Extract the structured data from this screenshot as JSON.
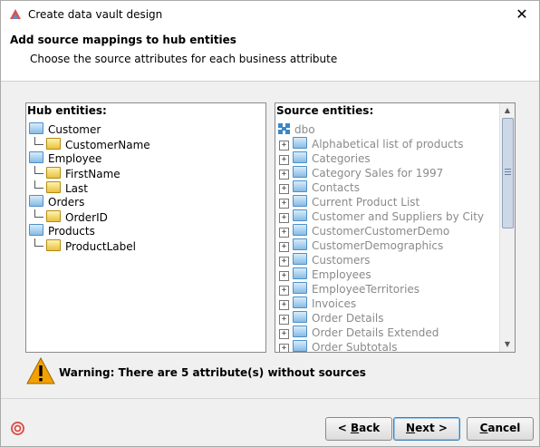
{
  "window": {
    "title": "Create data vault design",
    "close_glyph": "✕"
  },
  "header": {
    "heading": "Add source mappings to hub entities",
    "subheading": "Choose the source attributes for each business attribute"
  },
  "hub_panel": {
    "label": "Hub entities:",
    "tree": [
      {
        "text": "Customer",
        "level": 0,
        "icon": "folder-blue"
      },
      {
        "text": "CustomerName",
        "level": 1,
        "icon": "folder-yellow"
      },
      {
        "text": "Employee",
        "level": 0,
        "icon": "folder-blue"
      },
      {
        "text": "FirstName",
        "level": 1,
        "icon": "folder-yellow"
      },
      {
        "text": "Last",
        "level": 1,
        "icon": "folder-yellow"
      },
      {
        "text": "Orders",
        "level": 0,
        "icon": "folder-blue"
      },
      {
        "text": "OrderID",
        "level": 1,
        "icon": "folder-yellow"
      },
      {
        "text": "Products",
        "level": 0,
        "icon": "folder-blue"
      },
      {
        "text": "ProductLabel",
        "level": 1,
        "icon": "folder-yellow"
      }
    ]
  },
  "source_panel": {
    "label": "Source entities:",
    "root": "dbo",
    "items": [
      "Alphabetical list of products",
      "Categories",
      "Category Sales for 1997",
      "Contacts",
      "Current Product List",
      "Customer and Suppliers by City",
      "CustomerCustomerDemo",
      "CustomerDemographics",
      "Customers",
      "Employees",
      "EmployeeTerritories",
      "Invoices",
      "Order Details",
      "Order Details Extended",
      "Order Subtotals"
    ]
  },
  "warning": {
    "text": "Warning: There are 5 attribute(s) without sources"
  },
  "buttons": {
    "back": {
      "prefix": "< ",
      "mnemonic": "B",
      "rest": "ack"
    },
    "next": {
      "prefix": "",
      "mnemonic": "N",
      "rest": "ext >"
    },
    "cancel": {
      "prefix": "",
      "mnemonic": "C",
      "rest": "ancel"
    }
  },
  "colors": {
    "accent": "#3c7fb1",
    "warning": "#f2a100",
    "muted_text": "#8a8a8a"
  }
}
